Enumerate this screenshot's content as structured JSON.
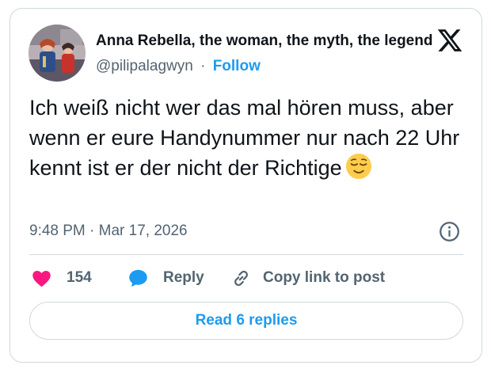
{
  "author": {
    "display_name": "Anna Rebella, the woman, the myth, the legend",
    "handle": "@pilipalagwyn",
    "separator": "·",
    "follow_label": "Follow",
    "avatar_icon": "avatar-photo"
  },
  "brand": {
    "icon": "x-logo-icon",
    "color": "#0f1419"
  },
  "tweet": {
    "text": "Ich weiß nicht wer das mal hören muss, aber wenn er eure Handynummer nur nach 22 Uhr kennt ist er der nicht der Richtige",
    "emoji_icon": "relieved-face-emoji"
  },
  "meta": {
    "timestamp": "9:48 PM · Mar 17, 2026",
    "info_icon": "info-icon"
  },
  "actions": {
    "like_count": "154",
    "like_icon": "heart-icon",
    "like_color": "#f91880",
    "reply_label": "Reply",
    "reply_icon": "speech-bubble-icon",
    "reply_color": "#1d9bf0",
    "copy_label": "Copy link to post",
    "copy_icon": "link-icon"
  },
  "footer": {
    "read_replies_label": "Read 6 replies"
  },
  "colors": {
    "accent": "#1d9bf0",
    "secondary_text": "#536471",
    "border": "#cfd9de"
  }
}
